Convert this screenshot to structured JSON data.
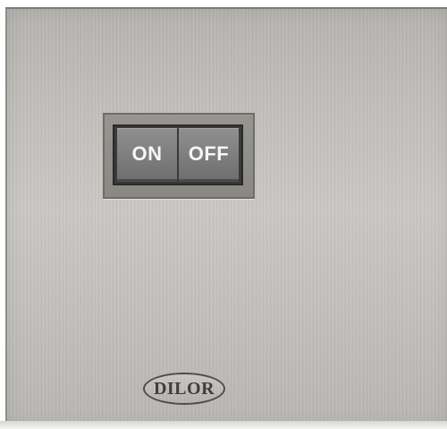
{
  "switch": {
    "on_label": "ON",
    "off_label": "OFF"
  },
  "brand": {
    "name": "DILOR"
  },
  "colors": {
    "panel": "#c2c0bd",
    "button": "#7c7c7c",
    "button_text": "#f6f6f6"
  }
}
